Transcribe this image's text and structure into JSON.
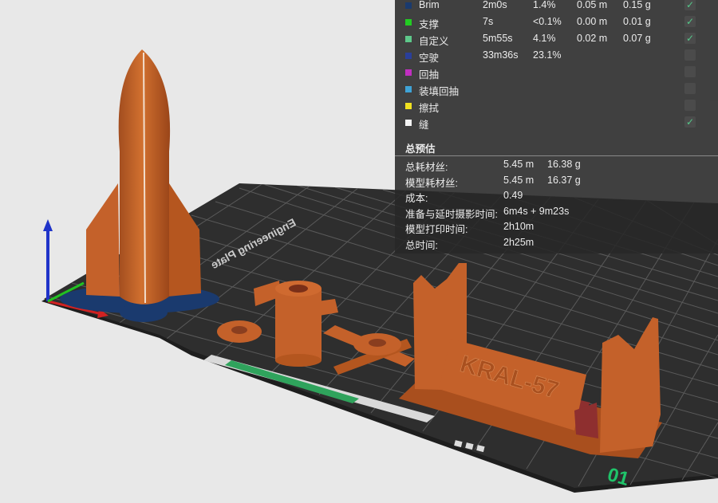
{
  "feature_rows": [
    {
      "name": "Brim",
      "time": "2m0s",
      "percent": "1.4%",
      "length": "0.05 m",
      "weight": "0.15 g",
      "color": "#1a3a6e",
      "visible": true
    },
    {
      "name": "支撑",
      "time": "7s",
      "percent": "<0.1%",
      "length": "0.00 m",
      "weight": "0.01 g",
      "color": "#22cc22",
      "visible": true
    },
    {
      "name": "自定义",
      "time": "5m55s",
      "percent": "4.1%",
      "length": "0.02 m",
      "weight": "0.07 g",
      "color": "#5ec88a",
      "visible": true
    },
    {
      "name": "空驶",
      "time": "33m36s",
      "percent": "23.1%",
      "length": "",
      "weight": "",
      "color": "#2a3f9a",
      "visible": false
    },
    {
      "name": "回抽",
      "time": "",
      "percent": "",
      "length": "",
      "weight": "",
      "color": "#c02fc0",
      "visible": false
    },
    {
      "name": "装填回抽",
      "time": "",
      "percent": "",
      "length": "",
      "weight": "",
      "color": "#3fa3d6",
      "visible": false
    },
    {
      "name": "擦拭",
      "time": "",
      "percent": "",
      "length": "",
      "weight": "",
      "color": "#f0e020",
      "visible": false
    },
    {
      "name": "缝",
      "time": "",
      "percent": "",
      "length": "",
      "weight": "",
      "color": "#f4f4f4",
      "visible": true
    }
  ],
  "checkmark_glyph": "✓",
  "summary": {
    "title": "总预估",
    "rows": [
      {
        "key": "总耗材丝:",
        "v1": "5.45 m",
        "v2": "16.38 g"
      },
      {
        "key": "模型耗材丝:",
        "v1": "5.45 m",
        "v2": "16.37 g"
      },
      {
        "key": "成本:",
        "v1": "0.49",
        "v2": ""
      },
      {
        "key": "准备与延时摄影时间:",
        "v1": "6m4s + 9m23s",
        "v2": ""
      },
      {
        "key": "模型打印时间:",
        "v1": "2h10m",
        "v2": ""
      },
      {
        "key": "总时间:",
        "v1": "2h25m",
        "v2": ""
      }
    ]
  },
  "plate": {
    "number_label": "01",
    "bed_text": "Engineering Plate",
    "model_text": "KRAL-57"
  },
  "colors": {
    "model": "#c8642c",
    "model_dark": "#8e4118",
    "brim": "#1a3a6e",
    "bed": "#2d2d2d",
    "grid": "#5c5c5c",
    "accent_green": "#1fc46a"
  }
}
